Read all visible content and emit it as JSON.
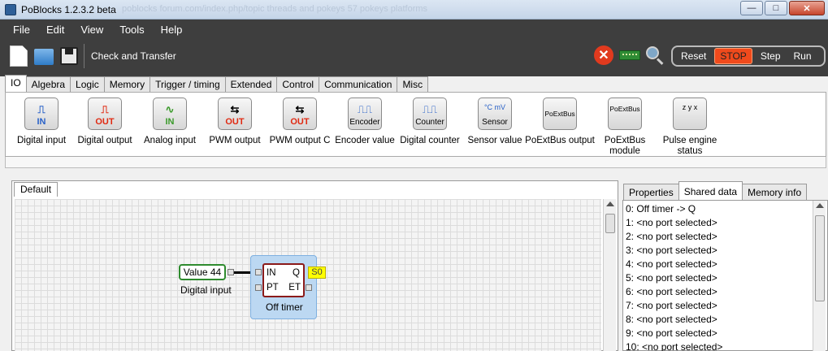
{
  "window": {
    "title": "PoBlocks 1.2.3.2 beta",
    "watermark": "poblocks forum.com/index.php/topic threads and pokeys 57 pokeys platforms",
    "controls": [
      "minimize-icon",
      "maximize-icon",
      "close-icon"
    ]
  },
  "menu": [
    {
      "label": "File"
    },
    {
      "label": "Edit"
    },
    {
      "label": "View"
    },
    {
      "label": "Tools"
    },
    {
      "label": "Help"
    }
  ],
  "toolbar": {
    "icons": [
      "new-file-icon",
      "open-folder-icon",
      "save-icon"
    ],
    "check_transfer": "Check and Transfer"
  },
  "status_icons": [
    "stop-error-icon",
    "board-icon",
    "search-icon"
  ],
  "run_controls": {
    "reset": "Reset",
    "stop": "STOP",
    "step": "Step",
    "run": "Run",
    "active": "STOP",
    "active_color": "#f04a1c"
  },
  "tabs": [
    {
      "label": "IO",
      "active": true
    },
    {
      "label": "Algebra"
    },
    {
      "label": "Logic"
    },
    {
      "label": "Memory"
    },
    {
      "label": "Trigger / timing"
    },
    {
      "label": "Extended"
    },
    {
      "label": "Control"
    },
    {
      "label": "Communication"
    },
    {
      "label": "Misc"
    }
  ],
  "palette": [
    {
      "glyph": "⎍",
      "tag": "IN",
      "label": "Digital input",
      "icon": "digital-input-icon"
    },
    {
      "glyph": "⎍",
      "tag": "OUT",
      "label": "Digital output",
      "icon": "digital-output-icon"
    },
    {
      "glyph": "∿",
      "tag": "IN",
      "label": "Analog input",
      "icon": "analog-input-icon"
    },
    {
      "glyph": "⇆",
      "tag": "OUT",
      "label": "PWM output",
      "icon": "pwm-output-icon"
    },
    {
      "glyph": "⇆",
      "tag": "OUT",
      "label": "PWM output C",
      "icon": "pwm-output-c-icon"
    },
    {
      "glyph": "⎍⎍",
      "tag": "Encoder",
      "label": "Encoder value",
      "icon": "encoder-icon"
    },
    {
      "glyph": "⎍⎍",
      "tag": "Counter",
      "label": "Digital counter",
      "icon": "counter-icon"
    },
    {
      "glyph": "°C mV",
      "tag": "Sensor",
      "label": "Sensor value",
      "icon": "sensor-icon"
    },
    {
      "glyph": "",
      "tag": "PoExtBus",
      "label": "PoExtBus output",
      "icon": "poextbus-output-icon"
    },
    {
      "glyph": "",
      "tag": "PoExtBus",
      "label": "PoExtBus module",
      "icon": "poextbus-module-icon"
    },
    {
      "glyph": "z y x",
      "tag": "",
      "label": "Pulse engine status",
      "icon": "pulse-engine-icon"
    }
  ],
  "document": {
    "tab": "Default"
  },
  "diagram": {
    "value_block": {
      "label": "Value 44",
      "caption": "Digital input"
    },
    "timer_block": {
      "in": "IN",
      "q": "Q",
      "pt": "PT",
      "et": "ET",
      "caption": "Off timer"
    },
    "shared_badge": "S0"
  },
  "right_panel": {
    "tabs": [
      {
        "label": "Properties"
      },
      {
        "label": "Shared data",
        "active": true
      },
      {
        "label": "Memory info"
      }
    ],
    "items": [
      "0: Off timer -> Q",
      "1: <no port selected>",
      "2: <no port selected>",
      "3: <no port selected>",
      "4: <no port selected>",
      "5: <no port selected>",
      "6: <no port selected>",
      "7: <no port selected>",
      "8: <no port selected>",
      "9: <no port selected>",
      "10: <no port selected>"
    ]
  },
  "colors": {
    "app_dark": "#3e3e3e",
    "stop_red": "#e13a1e",
    "block_green": "#2e8b2e",
    "block_red": "#8b1a1a",
    "badge_yellow": "#ffff00",
    "selection_blue": "#bcd8f2"
  }
}
